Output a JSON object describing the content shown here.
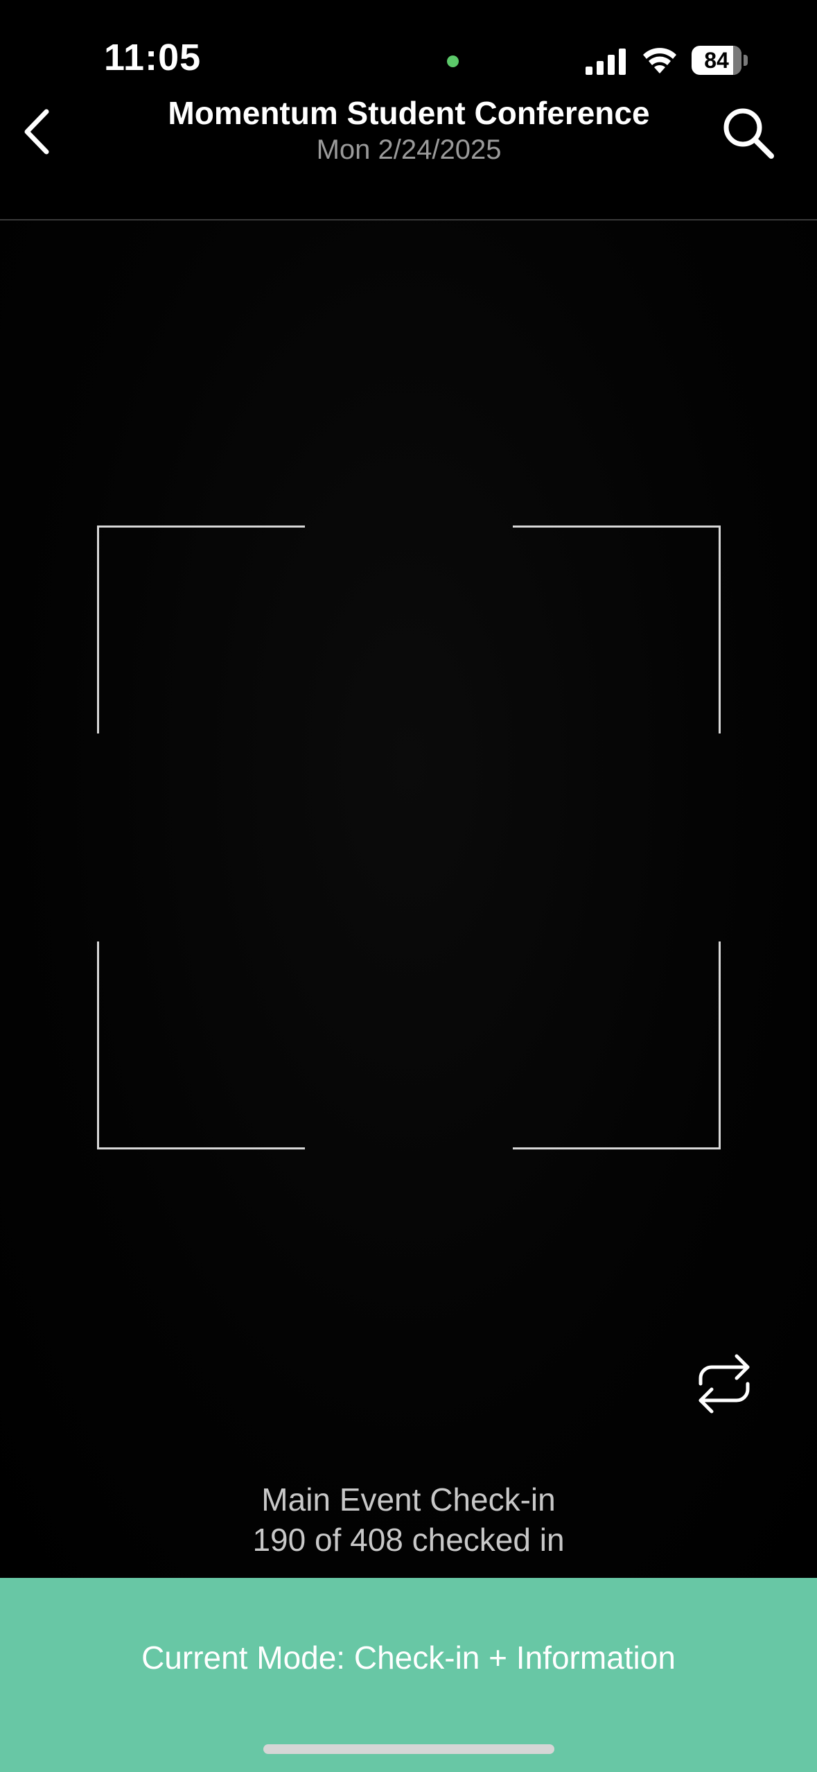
{
  "status_bar": {
    "time": "11:05",
    "battery_level": "84",
    "battery_fraction": 0.84
  },
  "header": {
    "title": "Momentum Student Conference",
    "subtitle": "Mon 2/24/2025"
  },
  "icons": {
    "back": "chevron-left-icon",
    "search": "search-icon",
    "switch_camera": "repeat-icon",
    "signal": "cellular-signal-icon",
    "wifi": "wifi-icon",
    "battery": "battery-icon"
  },
  "scanner": {
    "event_name": "Main Event Check-in",
    "checkin_count": "190 of 408 checked in"
  },
  "mode_bar": {
    "label": "Current Mode: Check-in + Information",
    "color": "#68c7a5"
  },
  "colors": {
    "background": "#000000",
    "privacy_indicator": "#5cc96a",
    "scan_frame": "#d8d8d8"
  }
}
